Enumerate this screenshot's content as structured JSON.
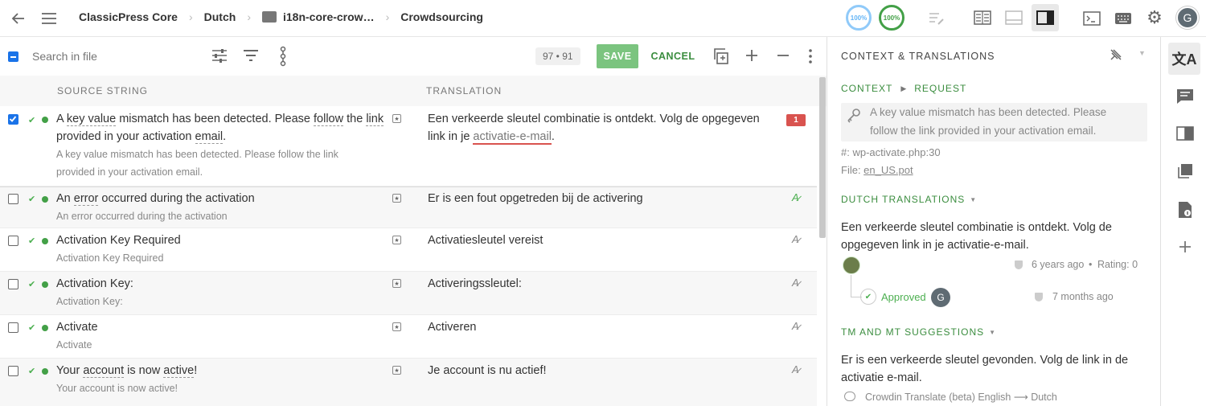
{
  "breadcrumb": {
    "project": "ClassicPress Core",
    "language": "Dutch",
    "file": "i18n-core-crow…",
    "page": "Crowdsourcing"
  },
  "progress": {
    "translated": "100%",
    "approved": "100%",
    "translated_value": 1.0,
    "approved_value": 1.0
  },
  "user_initial": "G",
  "toolbar": {
    "search_placeholder": "Search in file",
    "counter": "97 • 91",
    "save_label": "SAVE",
    "cancel_label": "CANCEL"
  },
  "columns": {
    "source": "SOURCE STRING",
    "translation": "TRANSLATION"
  },
  "rows": [
    {
      "source_parts": [
        "A ",
        "key value",
        " mismatch has been detected. Please ",
        "follow",
        " the ",
        "link",
        " provided in your activation ",
        "email",
        "."
      ],
      "subtitle": "A key value mismatch has been detected. Please follow the link provided in your activation email.",
      "translation_before": "Een verkeerde sleutel combinatie is ontdekt. Volg de opgegeven link in je ",
      "translation_err": "activatie-e-mail",
      "translation_after": ".",
      "badge": "1",
      "checked": true
    },
    {
      "source_before": "An ",
      "source_term": "error",
      "source_after": " occurred during the activation",
      "subtitle": "An error occurred during the activation",
      "translation": "Er is een fout opgetreden bij de activering"
    },
    {
      "source": "Activation Key Required",
      "subtitle": "Activation Key Required",
      "translation": "Activatiesleutel vereist"
    },
    {
      "source": "Activation Key:",
      "subtitle": "Activation Key:",
      "translation": "Activeringssleutel:"
    },
    {
      "source": "Activate",
      "subtitle": "Activate",
      "translation": "Activeren"
    },
    {
      "source_before": "Your ",
      "source_term": "account",
      "source_mid": " is now ",
      "source_term2": "active",
      "source_after": "!",
      "subtitle": "Your account is now active!",
      "translation": "Je account is nu actief!"
    }
  ],
  "panel": {
    "title": "CONTEXT & TRANSLATIONS",
    "context_label": "CONTEXT",
    "request_label": "REQUEST",
    "context_text": "A key value mismatch has been detected. Please follow the link provided in your activation email.",
    "hash_line": "#: wp-activate.php:30",
    "file_prefix": "File: ",
    "file_link": "en_US.pot",
    "dutch_title": "DUTCH TRANSLATIONS",
    "dutch_text": "Een verkeerde sleutel combinatie is ontdekt. Volg de opgegeven link in je activatie-e-mail.",
    "dutch_time": "6 years ago",
    "dutch_rating": "Rating: 0",
    "approved_label": "Approved",
    "approved_time": "7 months ago",
    "approver_initial": "G",
    "tm_title": "TM AND MT SUGGESTIONS",
    "tm_text": "Er is een verkeerde sleutel gevonden. Volg de link in de activatie e-mail.",
    "tm_source": "Crowdin Translate (beta) English ⟶ Dutch"
  },
  "colors": {
    "accent_green": "#3b8d3f",
    "save_bg": "#7bc47f",
    "error_badge": "#d9534f",
    "approve_circle": "#43a047",
    "translate_circle": "#90caf9"
  }
}
